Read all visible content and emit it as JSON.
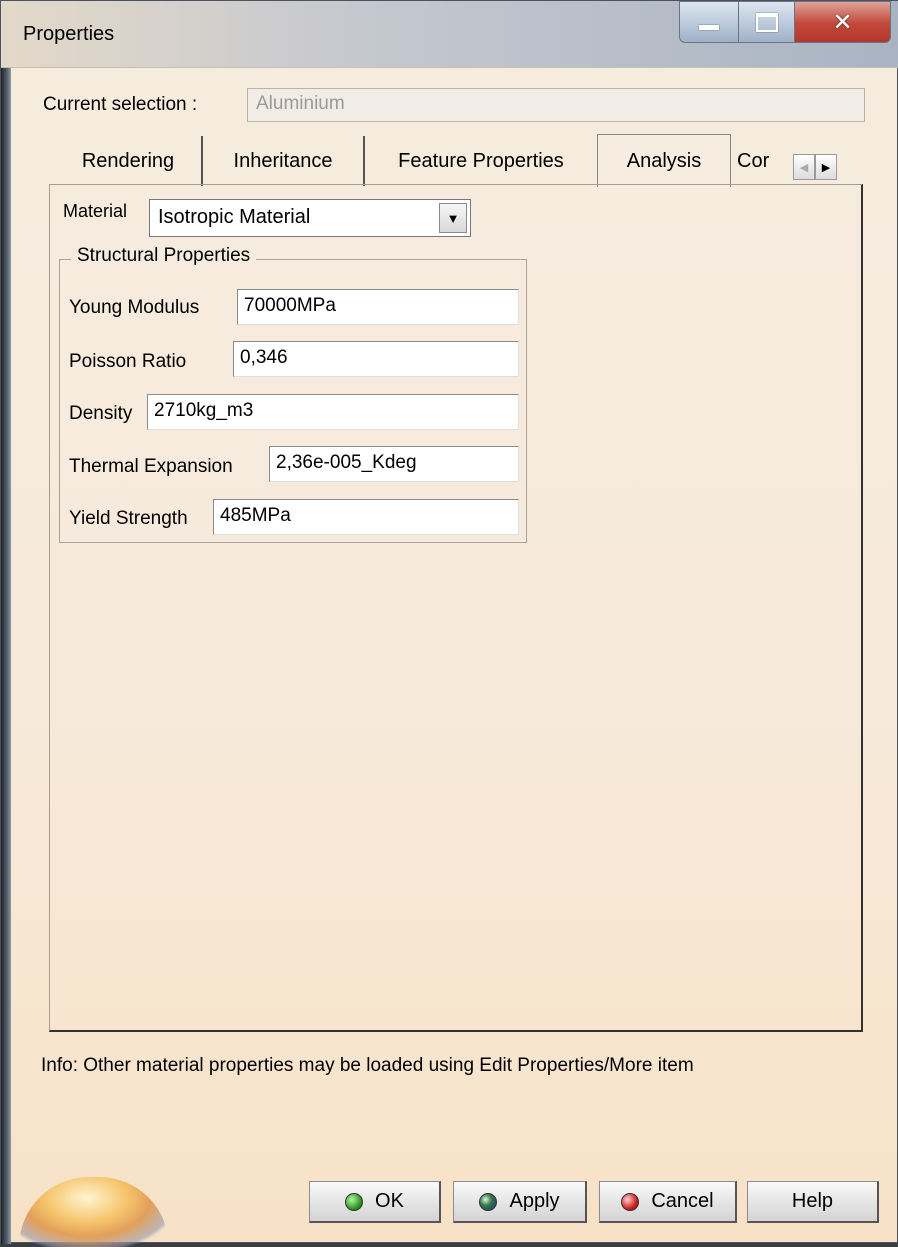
{
  "window": {
    "title": "Properties",
    "icons": {
      "minimize": "minimize-icon",
      "maximize": "maximize-icon",
      "close": "close-icon"
    }
  },
  "selection": {
    "label": "Current selection :",
    "value": "Aluminium"
  },
  "tabs": [
    {
      "label": "Rendering",
      "active": false
    },
    {
      "label": "Inheritance",
      "active": false
    },
    {
      "label": "Feature Properties",
      "active": false
    },
    {
      "label": "Analysis",
      "active": true
    },
    {
      "label": "Cor",
      "active": false
    }
  ],
  "analysis": {
    "material_label": "Material",
    "material_value": "Isotropic Material",
    "group_title": "Structural Properties",
    "properties": [
      {
        "label": "Young Modulus",
        "value": "70000MPa"
      },
      {
        "label": "Poisson Ratio",
        "value": "0,346"
      },
      {
        "label": "Density",
        "value": "2710kg_m3"
      },
      {
        "label": "Thermal Expansion",
        "value": "2,36e-005_Kdeg"
      },
      {
        "label": "Yield Strength",
        "value": "485MPa"
      }
    ]
  },
  "info": "Info: Other material properties may be loaded using Edit Properties/More item",
  "buttons": {
    "ok": "OK",
    "apply": "Apply",
    "cancel": "Cancel",
    "help": "Help"
  },
  "colors": {
    "background": "#f6eada",
    "close_button": "#c2483a",
    "ok_dot": "#2f9a26",
    "cancel_dot": "#d02020"
  }
}
